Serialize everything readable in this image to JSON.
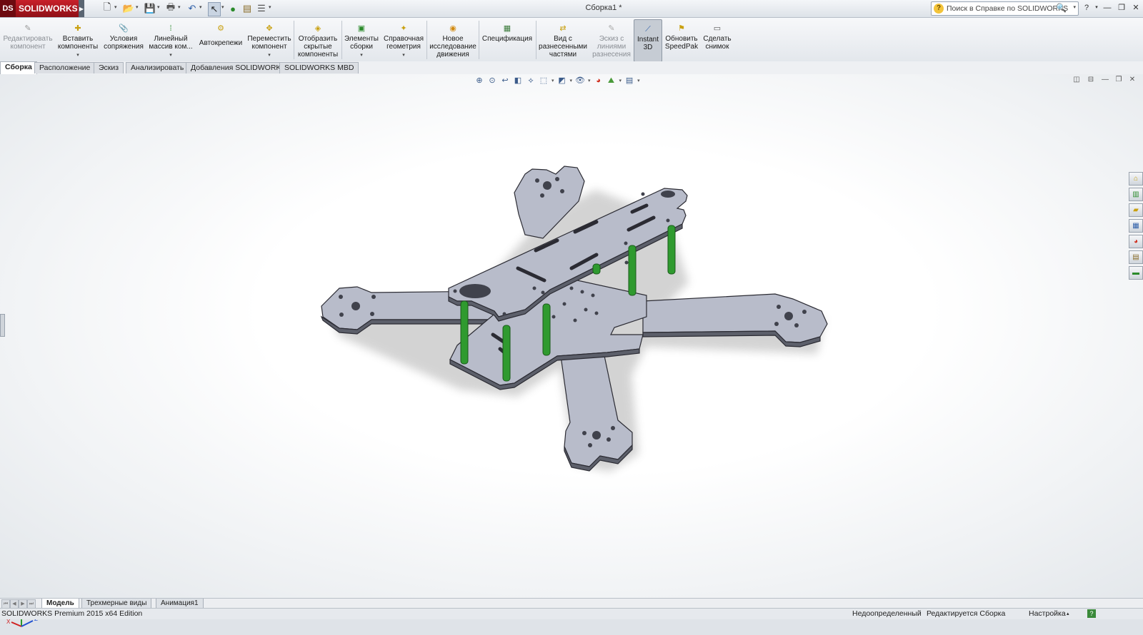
{
  "app": {
    "brand": "SOLIDWORKS",
    "title": "Сборка1 *"
  },
  "help_search": {
    "placeholder": "Поиск в Справке по SOLIDWORKS"
  },
  "commands": [
    {
      "label1": "Редактировать",
      "label2": "компонент",
      "label3": "",
      "icon": "edit-component-icon"
    },
    {
      "label1": "Вставить",
      "label2": "компоненты",
      "label3": "",
      "icon": "insert-components-icon"
    },
    {
      "label1": "Условия",
      "label2": "сопряжения",
      "label3": "",
      "icon": "mate-icon"
    },
    {
      "label1": "Линейный",
      "label2": "массив ком...",
      "label3": "",
      "icon": "linear-pattern-icon"
    },
    {
      "label1": "Автокрепежи",
      "label2": "",
      "label3": "",
      "icon": "smart-fasteners-icon"
    },
    {
      "label1": "Переместить",
      "label2": "компонент",
      "label3": "",
      "icon": "move-component-icon"
    },
    {
      "label1": "Отобразить",
      "label2": "скрытые",
      "label3": "компоненты",
      "icon": "show-hidden-icon"
    },
    {
      "label1": "Элементы",
      "label2": "сборки",
      "label3": "",
      "icon": "assembly-features-icon"
    },
    {
      "label1": "Справочная",
      "label2": "геометрия",
      "label3": "",
      "icon": "reference-geometry-icon"
    },
    {
      "label1": "Новое",
      "label2": "исследование",
      "label3": "движения",
      "icon": "motion-study-icon"
    },
    {
      "label1": "Спецификация",
      "label2": "",
      "label3": "",
      "icon": "bom-icon"
    },
    {
      "label1": "Вид с",
      "label2": "разнесенными",
      "label3": "частями",
      "icon": "exploded-view-icon"
    },
    {
      "label1": "Эскиз с",
      "label2": "линиями",
      "label3": "разнесения",
      "icon": "explode-line-sketch-icon"
    },
    {
      "label1": "Instant",
      "label2": "3D",
      "label3": "",
      "icon": "instant3d-icon"
    },
    {
      "label1": "Обновить",
      "label2": "SpeedPak",
      "label3": "",
      "icon": "speedpak-icon"
    },
    {
      "label1": "Сделать",
      "label2": "снимок",
      "label3": "",
      "icon": "snapshot-icon"
    }
  ],
  "tabs": [
    "Сборка",
    "Расположение",
    "Эскиз",
    "Анализировать",
    "Добавления SOLIDWORKS",
    "SOLIDWORKS MBD"
  ],
  "bottom_tabs": [
    "Модель",
    "Трехмерные виды",
    "Анимация1"
  ],
  "status": {
    "edition": "SOLIDWORKS Premium 2015 x64 Edition",
    "definition": "Недоопределенный",
    "editing": "Редактируется Сборка",
    "settings": "Настройка",
    "help": "?"
  },
  "triad": {
    "x": "X",
    "y": "Y",
    "z": "Z"
  },
  "colors": {
    "frame": "#b8bcca",
    "standoff": "#2f9a2f",
    "brand": "#c8202a"
  }
}
